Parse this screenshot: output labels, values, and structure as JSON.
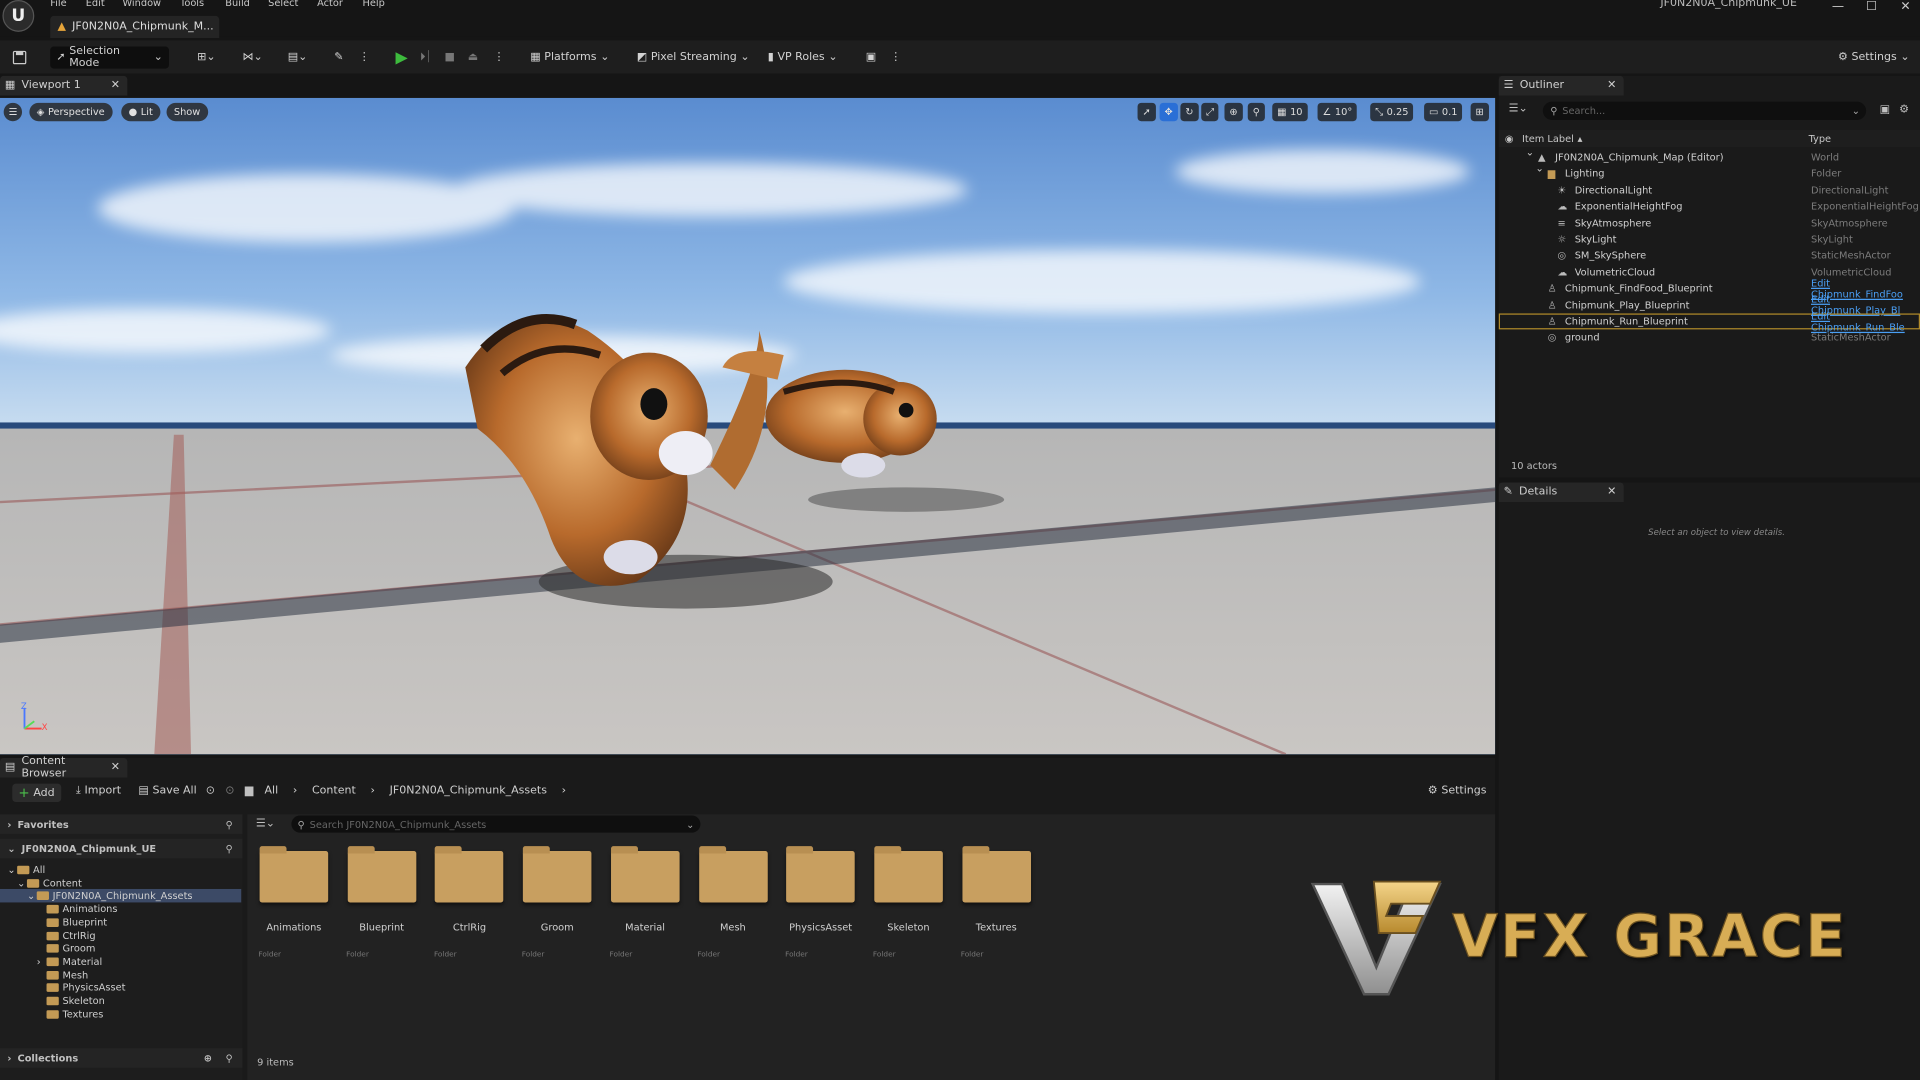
{
  "menu": [
    "File",
    "Edit",
    "Window",
    "Tools",
    "Build",
    "Select",
    "Actor",
    "Help"
  ],
  "app_logo": "U",
  "document_tab": "JF0N2N0A_Chipmunk_M...",
  "window_title": "JF0N2N0A_Chipmunk_UE",
  "toolbar": {
    "mode": "Selection Mode",
    "platforms": "Platforms",
    "pixel_streaming": "Pixel Streaming",
    "vp_roles": "VP Roles",
    "settings": "Settings"
  },
  "viewport": {
    "tab": "Viewport 1",
    "perspective": "Perspective",
    "lit": "Lit",
    "show": "Show",
    "grid_snap": "10",
    "rotation_snap": "10°",
    "scale_snap": "0.25",
    "camera_speed": "0.1",
    "axis_z": "Z",
    "axis_x": "X"
  },
  "outliner": {
    "tab": "Outliner",
    "search_placeholder": "Search...",
    "col_label": "Item Label",
    "col_type": "Type",
    "rows": [
      {
        "label": "JF0N2N0A_Chipmunk_Map (Editor)",
        "type": "World"
      },
      {
        "label": "Lighting",
        "type": "Folder"
      },
      {
        "label": "DirectionalLight",
        "type": "DirectionalLight"
      },
      {
        "label": "ExponentialHeightFog",
        "type": "ExponentialHeightFog"
      },
      {
        "label": "SkyAtmosphere",
        "type": "SkyAtmosphere"
      },
      {
        "label": "SkyLight",
        "type": "SkyLight"
      },
      {
        "label": "SM_SkySphere",
        "type": "StaticMeshActor"
      },
      {
        "label": "VolumetricCloud",
        "type": "VolumetricCloud"
      },
      {
        "label": "Chipmunk_FindFood_Blueprint",
        "type": "Edit Chipmunk_FindFoo"
      },
      {
        "label": "Chipmunk_Play_Blueprint",
        "type": "Edit Chipmunk_Play_Bl"
      },
      {
        "label": "Chipmunk_Run_Blueprint",
        "type": "Edit Chipmunk_Run_Ble"
      },
      {
        "label": "ground",
        "type": "StaticMeshActor"
      }
    ],
    "actor_count": "10 actors"
  },
  "details": {
    "tab": "Details",
    "empty_message": "Select an object to view details."
  },
  "content_browser": {
    "tab": "Content Browser",
    "add": "Add",
    "import": "Import",
    "save_all": "Save All",
    "breadcrumb": [
      "All",
      "Content",
      "JF0N2N0A_Chipmunk_Assets"
    ],
    "settings": "Settings",
    "favorites": "Favorites",
    "project": "JF0N2N0A_Chipmunk_UE",
    "search_placeholder": "Search JF0N2N0A_Chipmunk_Assets",
    "tree": [
      "All",
      "Content",
      "JF0N2N0A_Chipmunk_Assets",
      "Animations",
      "Blueprint",
      "CtrlRig",
      "Groom",
      "Material",
      "Mesh",
      "PhysicsAsset",
      "Skeleton",
      "Textures"
    ],
    "folders": [
      "Animations",
      "Blueprint",
      "CtrlRig",
      "Groom",
      "Material",
      "Mesh",
      "PhysicsAsset",
      "Skeleton",
      "Textures"
    ],
    "folder_type": "Folder",
    "collections": "Collections",
    "item_count": "9 items"
  },
  "watermark": {
    "text": "VFX GRACE"
  }
}
